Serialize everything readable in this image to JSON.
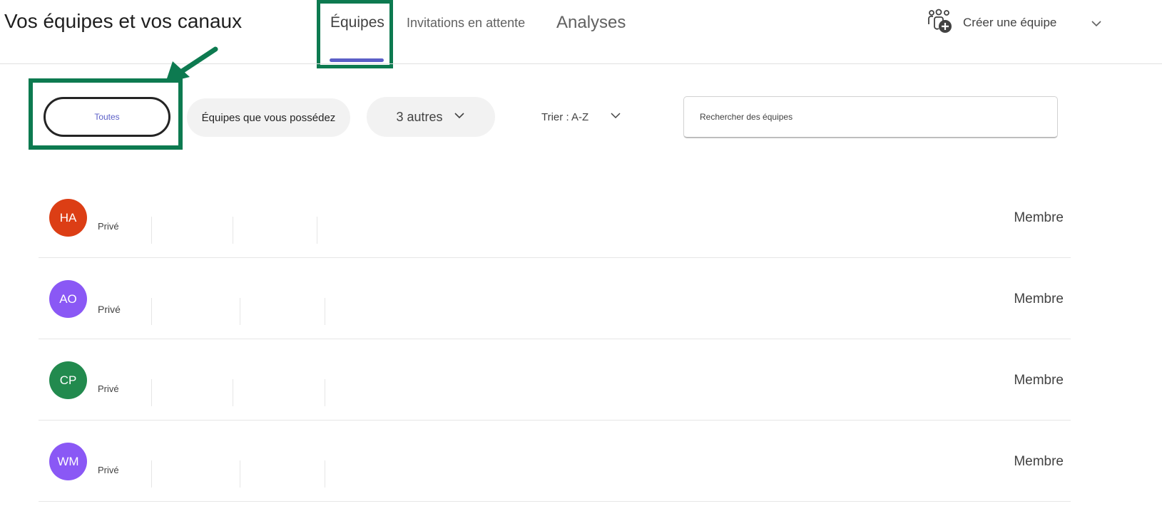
{
  "header": {
    "title": "Vos équipes et vos canaux",
    "tabs": [
      {
        "label": "Équipes",
        "active": true
      },
      {
        "label": "Invitations en attente",
        "active": false
      },
      {
        "label": "Analyses",
        "active": false
      }
    ],
    "create_team_label": "Créer une équipe",
    "create_team_icon": "people-add-icon",
    "more_icon": "chevron-down-icon"
  },
  "filters": {
    "all_label": "Toutes",
    "owned_label": "Équipes que vous possédez",
    "others_label": "3 autres",
    "sort_label": "Trier : A-Z",
    "search_placeholder": "Rechercher des équipes"
  },
  "teams": [
    {
      "initials": "HA",
      "color": "#dc3e15",
      "privacy": "Privé",
      "role": "Membre"
    },
    {
      "initials": "AO",
      "color": "#8a58f5",
      "privacy": "Privé",
      "role": "Membre"
    },
    {
      "initials": "CP",
      "color": "#228a4e",
      "privacy": "Privé",
      "role": "Membre"
    },
    {
      "initials": "WM",
      "color": "#8a58f5",
      "privacy": "Privé",
      "role": "Membre"
    }
  ],
  "colors": {
    "accent": "#5b5fc7",
    "highlight": "#0d7a50"
  }
}
